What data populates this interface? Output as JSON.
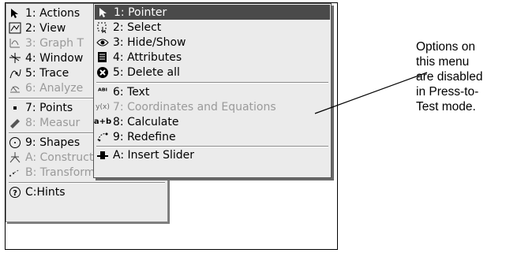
{
  "main_menu": {
    "items": [
      {
        "label": "1: Actions",
        "icon": "arrow-cursor-icon",
        "enabled": true
      },
      {
        "label": "2: View",
        "icon": "view-icon",
        "enabled": true
      },
      {
        "label": "3: Graph T",
        "icon": "graph-type-icon",
        "enabled": false
      },
      {
        "label": "4: Window",
        "icon": "window-zoom-icon",
        "enabled": true
      },
      {
        "label": "5: Trace",
        "icon": "trace-icon",
        "enabled": true
      },
      {
        "label": "6: Analyze",
        "icon": "analyze-icon",
        "enabled": false
      },
      {
        "label": "7: Points",
        "icon": "point-icon",
        "enabled": true
      },
      {
        "label": "8: Measur",
        "icon": "ruler-icon",
        "enabled": false
      },
      {
        "label": "9: Shapes",
        "icon": "circle-shape-icon",
        "enabled": true
      },
      {
        "label": "A: Construction",
        "icon": "construction-icon",
        "enabled": false
      },
      {
        "label": "B: Transformation",
        "icon": "transformation-icon",
        "enabled": false
      },
      {
        "label": "C:Hints",
        "icon": "help-icon",
        "enabled": true
      }
    ]
  },
  "submenu": {
    "items": [
      {
        "label": "1: Pointer",
        "icon": "arrow-cursor-icon",
        "enabled": true,
        "selected": true
      },
      {
        "label": "2: Select",
        "icon": "select-icon",
        "enabled": true
      },
      {
        "label": "3: Hide/Show",
        "icon": "eye-icon",
        "enabled": true
      },
      {
        "label": "4: Attributes",
        "icon": "attributes-icon",
        "enabled": true
      },
      {
        "label": "5: Delete all",
        "icon": "delete-icon",
        "enabled": true
      },
      {
        "label": "6: Text",
        "icon": "text-icon",
        "enabled": true
      },
      {
        "label": "7: Coordinates and Equations",
        "icon": "coordinates-icon",
        "enabled": false
      },
      {
        "label": "8: Calculate",
        "icon": "calculate-icon",
        "enabled": true
      },
      {
        "label": "9: Redefine",
        "icon": "redefine-icon",
        "enabled": true
      },
      {
        "label": "A: Insert Slider",
        "icon": "slider-icon",
        "enabled": true
      }
    ]
  },
  "annotation": {
    "lines": [
      "Options on",
      "this menu",
      "are disabled",
      "in Press-to-",
      "Test mode."
    ]
  }
}
